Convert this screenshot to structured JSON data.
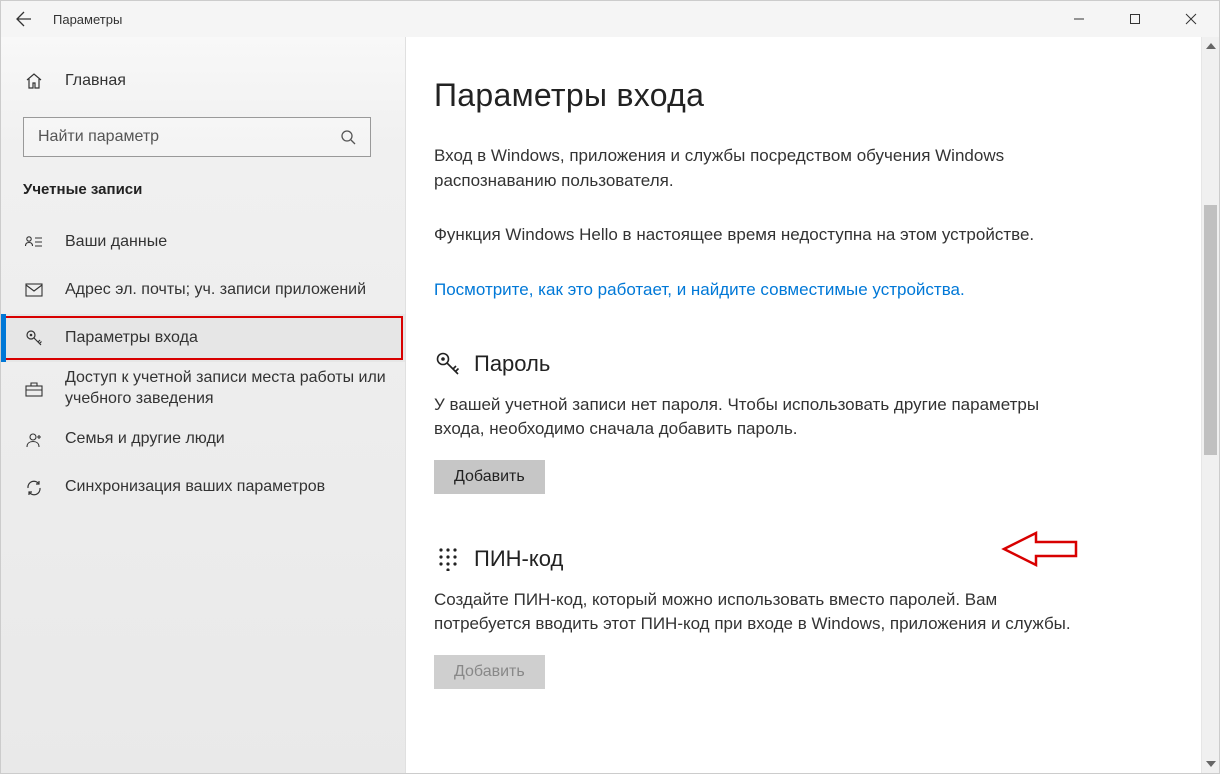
{
  "titlebar": {
    "title": "Параметры"
  },
  "sidebar": {
    "home": "Главная",
    "search_placeholder": "Найти параметр",
    "section": "Учетные записи",
    "items": [
      {
        "label": "Ваши данные"
      },
      {
        "label": "Адрес эл. почты; уч. записи приложений"
      },
      {
        "label": "Параметры входа"
      },
      {
        "label": "Доступ к учетной записи места работы или учебного заведения"
      },
      {
        "label": "Семья и другие люди"
      },
      {
        "label": "Синхронизация ваших параметров"
      }
    ]
  },
  "main": {
    "title": "Параметры входа",
    "intro": "Вход в Windows, приложения и службы посредством обучения Windows распознаванию пользователя.",
    "hello_unavailable": "Функция Windows Hello в настоящее время недоступна на этом устройстве.",
    "link": "Посмотрите, как это работает, и найдите совместимые устройства.",
    "password": {
      "heading": "Пароль",
      "desc": "У вашей учетной записи нет пароля. Чтобы использовать другие параметры входа, необходимо сначала добавить пароль.",
      "button": "Добавить"
    },
    "pin": {
      "heading": "ПИН-код",
      "desc": "Создайте ПИН-код, который можно использовать вместо паролей. Вам потребуется вводить этот ПИН-код при входе в Windows, приложения и службы.",
      "button": "Добавить"
    }
  }
}
